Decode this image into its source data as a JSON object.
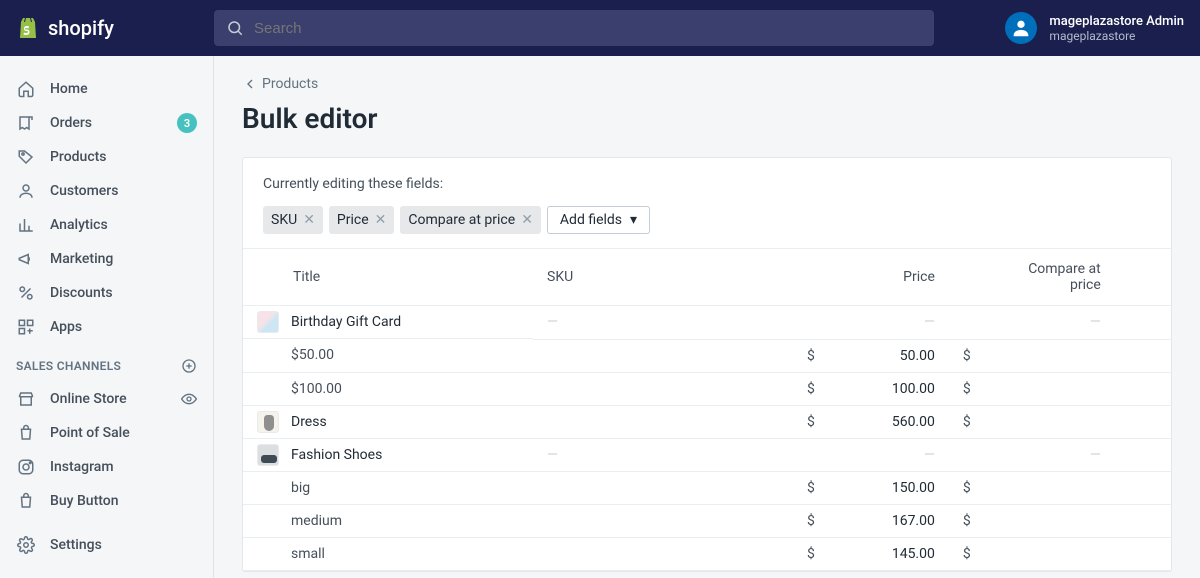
{
  "brand": "shopify",
  "search": {
    "placeholder": "Search"
  },
  "user": {
    "name": "mageplazastore Admin",
    "sub": "mageplazastore"
  },
  "sidebar": {
    "items": [
      {
        "label": "Home"
      },
      {
        "label": "Orders",
        "badge": "3"
      },
      {
        "label": "Products"
      },
      {
        "label": "Customers"
      },
      {
        "label": "Analytics"
      },
      {
        "label": "Marketing"
      },
      {
        "label": "Discounts"
      },
      {
        "label": "Apps"
      }
    ],
    "section_label": "SALES CHANNELS",
    "channels": [
      {
        "label": "Online Store"
      },
      {
        "label": "Point of Sale"
      },
      {
        "label": "Instagram"
      },
      {
        "label": "Buy Button"
      }
    ],
    "settings": "Settings"
  },
  "breadcrumb": "Products",
  "page_title": "Bulk editor",
  "editing_label": "Currently editing these fields:",
  "tags": [
    "SKU",
    "Price",
    "Compare at price"
  ],
  "add_fields_label": "Add fields",
  "columns": {
    "title": "Title",
    "sku": "SKU",
    "price": "Price",
    "compare": "Compare at price"
  },
  "currency": "$",
  "rows": [
    {
      "type": "product",
      "title": "Birthday Gift Card",
      "sku_dash": true,
      "price_dash": true,
      "compare_dash": true,
      "thumb": "gift"
    },
    {
      "type": "variant",
      "title": "$50.00",
      "price": "50.00",
      "compare": ""
    },
    {
      "type": "variant",
      "title": "$100.00",
      "price": "100.00",
      "compare": ""
    },
    {
      "type": "product",
      "title": "Dress",
      "price": "560.00",
      "compare": "",
      "thumb": "dress"
    },
    {
      "type": "product",
      "title": "Fashion Shoes",
      "sku_dash": true,
      "price_dash": true,
      "compare_dash": true,
      "thumb": "shoes"
    },
    {
      "type": "variant",
      "title": "big",
      "price": "150.00",
      "compare": ""
    },
    {
      "type": "variant",
      "title": "medium",
      "price": "167.00",
      "compare": ""
    },
    {
      "type": "variant",
      "title": "small",
      "price": "145.00",
      "compare": ""
    }
  ]
}
